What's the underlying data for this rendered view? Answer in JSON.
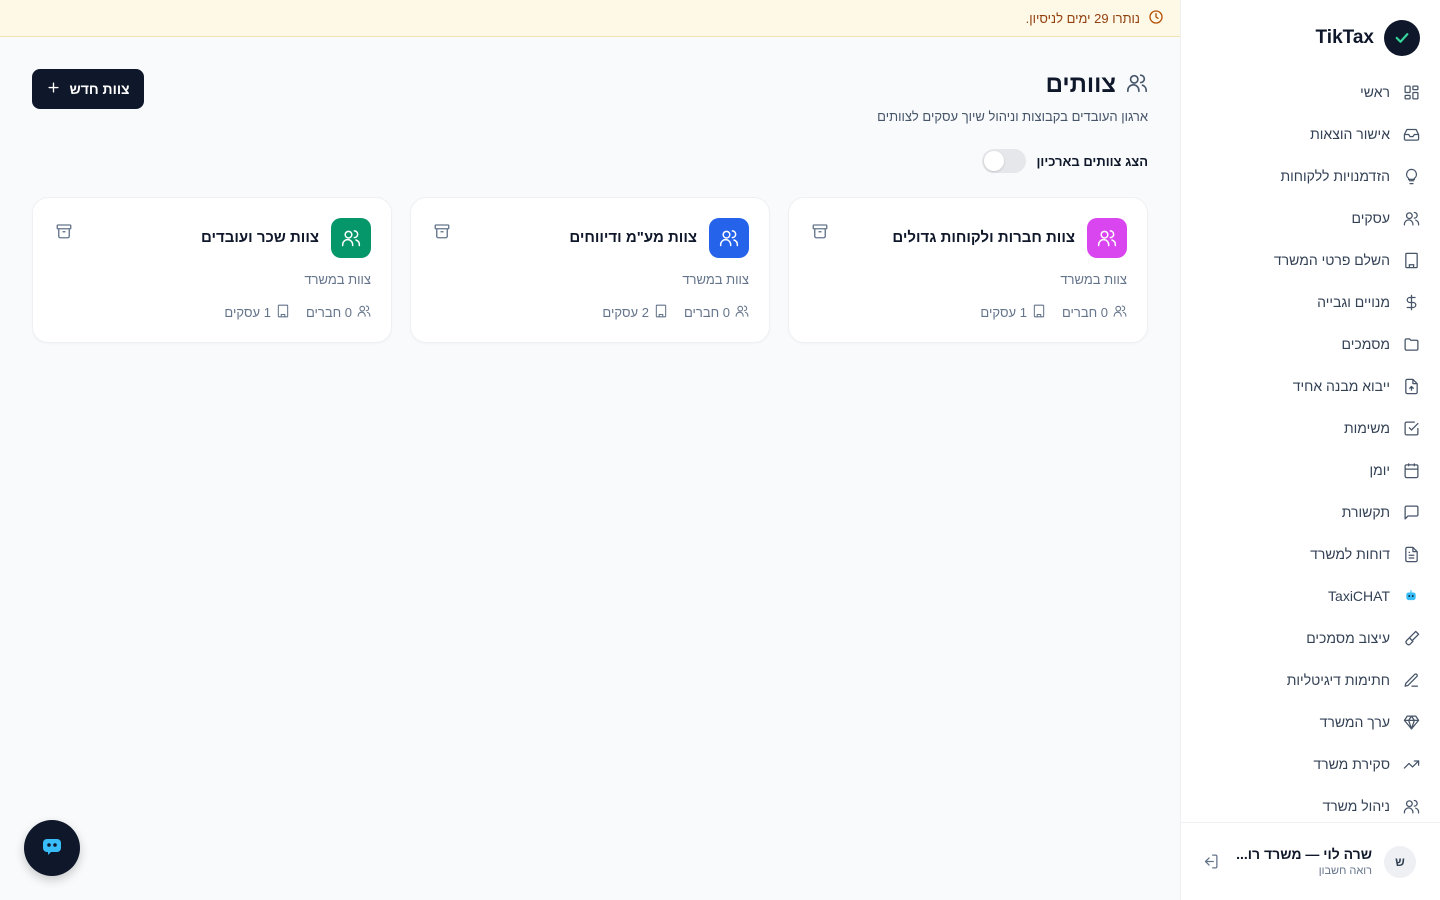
{
  "brand": {
    "name": "TikTax",
    "logo_icon": "check-icon"
  },
  "trial_banner": {
    "text": "נותרו 29 ימים לניסיון.",
    "icon": "clock-icon"
  },
  "sidebar": {
    "items": [
      {
        "label": "ראשי",
        "icon": "grid-icon"
      },
      {
        "label": "אישור הוצאות",
        "icon": "inbox-icon"
      },
      {
        "label": "הזדמנויות ללקוחות",
        "icon": "lightbulb-icon"
      },
      {
        "label": "עסקים",
        "icon": "users-icon"
      },
      {
        "label": "השלם פרטי המשרד",
        "icon": "building-icon"
      },
      {
        "label": "מנויים וגבייה",
        "icon": "dollar-icon"
      },
      {
        "label": "מסמכים",
        "icon": "folder-icon"
      },
      {
        "label": "ייבוא מבנה אחיד",
        "icon": "file-upload-icon"
      },
      {
        "label": "משימות",
        "icon": "checkbox-icon"
      },
      {
        "label": "יומן",
        "icon": "calendar-icon"
      },
      {
        "label": "תקשורת",
        "icon": "message-icon"
      },
      {
        "label": "דוחות למשרד",
        "icon": "file-text-icon"
      },
      {
        "label": "TaxiCHAT",
        "icon": "bot-icon"
      },
      {
        "label": "עיצוב מסמכים",
        "icon": "brush-icon"
      },
      {
        "label": "חתימות דיגיטליות",
        "icon": "signature-icon"
      },
      {
        "label": "ערך המשרד",
        "icon": "diamond-icon"
      },
      {
        "label": "סקירת משרד",
        "icon": "trending-up-icon"
      },
      {
        "label": "ניהול משרד",
        "icon": "users-icon"
      }
    ]
  },
  "user": {
    "initial": "ש",
    "name": "שרה לוי — משרד רו...",
    "role": "רואה חשבון"
  },
  "page": {
    "title": "צוותים",
    "subtitle": "ארגון העובדים בקבוצות וניהול שיוך עסקים לצוותים",
    "new_button": "צוות חדש",
    "archive_toggle_label": "הצג צוותים בארכיון",
    "archive_toggle_on": false
  },
  "teams": [
    {
      "name": "צוות חברות ולקוחות גדולים",
      "type": "צוות במשרד",
      "members": "0 חברים",
      "businesses": "1 עסקים",
      "color": "#d946ef"
    },
    {
      "name": "צוות מע\"מ ודיווחים",
      "type": "צוות במשרד",
      "members": "0 חברים",
      "businesses": "2 עסקים",
      "color": "#2563eb"
    },
    {
      "name": "צוות שכר ועובדים",
      "type": "צוות במשרד",
      "members": "0 חברים",
      "businesses": "1 עסקים",
      "color": "#059669"
    }
  ],
  "colors": {
    "primary": "#0f172a",
    "banner_bg": "#fef9e7",
    "banner_text": "#92400e"
  }
}
